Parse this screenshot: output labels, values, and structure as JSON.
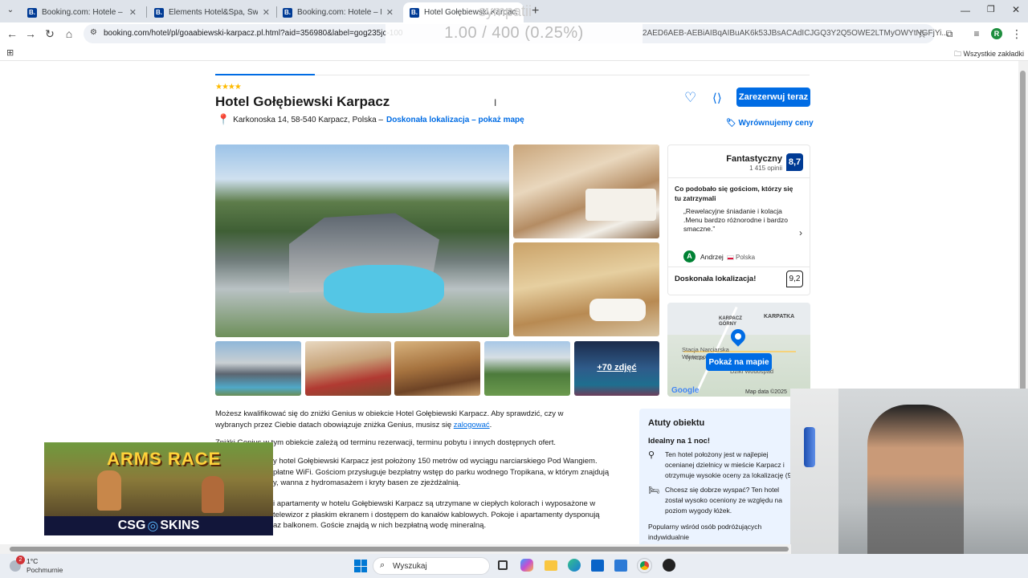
{
  "browser": {
    "tabs": [
      {
        "title": "Booking.com: Hotele – Świerad",
        "favicon": "B."
      },
      {
        "title": "Elements Hotel&Spa, Świeradó",
        "favicon": "B."
      },
      {
        "title": "Booking.com: Hotele – Karpacz",
        "favicon": "B."
      },
      {
        "title": "Hotel Gołębiewski Karpacz",
        "favicon": "B."
      }
    ],
    "url": "booking.com/hotel/pl/goaabiewski-karpacz.pl.html?aid=356980&label=gog235jc-100",
    "url_tail": "2AED6AEB-AEBiAIBqAIBuAK6k53JBsACAdICJGQ3Y2Q5OWE2LTMyOWYtNGFjYi...",
    "overlay_text": "1.00 / 400 (0.25%)",
    "overlay_symbol": "sympatii",
    "bookmarks_label": "Wszystkie zakładki",
    "profile_initial": "R"
  },
  "hotel": {
    "stars": "★★★★",
    "name": "Hotel Gołębiewski Karpacz",
    "address": "Karkonoska 14, 58-540 Karpacz, Polska –",
    "map_link": "Doskonała lokalizacja – pokaż mapę",
    "reserve_button": "Zarezerwuj teraz",
    "price_match": "Wyrównujemy ceny",
    "more_photos": "+70 zdjęć"
  },
  "review": {
    "rating_word": "Fantastyczny",
    "count": "1 415 opinii",
    "score": "8,7",
    "liked_heading": "Co podobało się gościom, którzy się tu zatrzymali",
    "quote": "„Rewelacyjne śniadanie i kolacja .Menu bardzo różnorodne i bardzo smaczne.”",
    "reviewer_initial": "A",
    "reviewer": "Andrzej",
    "country": "Polska",
    "location_label": "Doskonała lokalizacja!",
    "location_score": "9,2"
  },
  "map": {
    "label_karpatka": "KARPATKA",
    "label_karpacz": "KARPACZ GÓRNY",
    "label_stacja": "Stacja Narciarska Winterpol Karpacz",
    "label_tymczasowy": "Tymcza",
    "label_dziki": "Dziki Wodospad",
    "button": "Pokaż na mapie",
    "google": "Google",
    "credit": "Map data ©2025"
  },
  "description": {
    "genius": "Możesz kwalifikować się do zniżki Genius w obiekcie Hotel Gołębiewski Karpacz. Aby sprawdzić, czy w wybranych przez Ciebie datach obowiązuje zniżka Genius, musisz się",
    "login_link": "zalogować",
    "genius2": "Zniżki Genius w tym obiekcie zależą od terminu rezerwacji, terminu pobytu i innych dostępnych ofert.",
    "p1": "y hotel Gołębiewski Karpacz jest położony 150 metrów od wyciągu narciarskiego Pod Wangiem.",
    "p1b": "płatne WiFi. Gościom przysługuje bezpłatny wstęp do parku wodnego Tropikana, w którym znajdują",
    "p1c": "y, wanna z hydromasażem i kryty basen ze zjeżdżalnią.",
    "p2": "i apartamenty w hotelu Gołębiewski Karpacz są utrzymane w ciepłych kolorach i wyposażone w",
    "p2b": "telewizor z płaskim ekranem i dostępem do kanałów kablowych. Pokoje i apartamenty dysponują",
    "p2c": "az balkonem. Goście znajdą w nich bezpłatną wodę mineralną."
  },
  "highlights": {
    "title": "Atuty obiektu",
    "ideal": "Idealny na 1 noc!",
    "item1": "Ten hotel położony jest w najlepiej ocenianej dzielnicy w mieście Karpacz i otrzymuje wysokie oceny za lokalizację (9",
    "item2": "Chcesz się dobrze wyspać? Ten hotel został wysoko oceniony ze względu na poziom wygody łóżek.",
    "popular": "Popularny wśród osób podróżujących indywidualnie"
  },
  "ad": {
    "title": "ARMS RACE",
    "brand": "CSG",
    "brand2": "SKINS"
  },
  "taskbar": {
    "temp": "1°C",
    "weather": "Pochmurnie",
    "search": "Wyszukaj",
    "badge": "2"
  },
  "colors": {
    "brand_blue": "#006ce4",
    "score_navy": "#003b95",
    "star_gold": "#febb02"
  }
}
